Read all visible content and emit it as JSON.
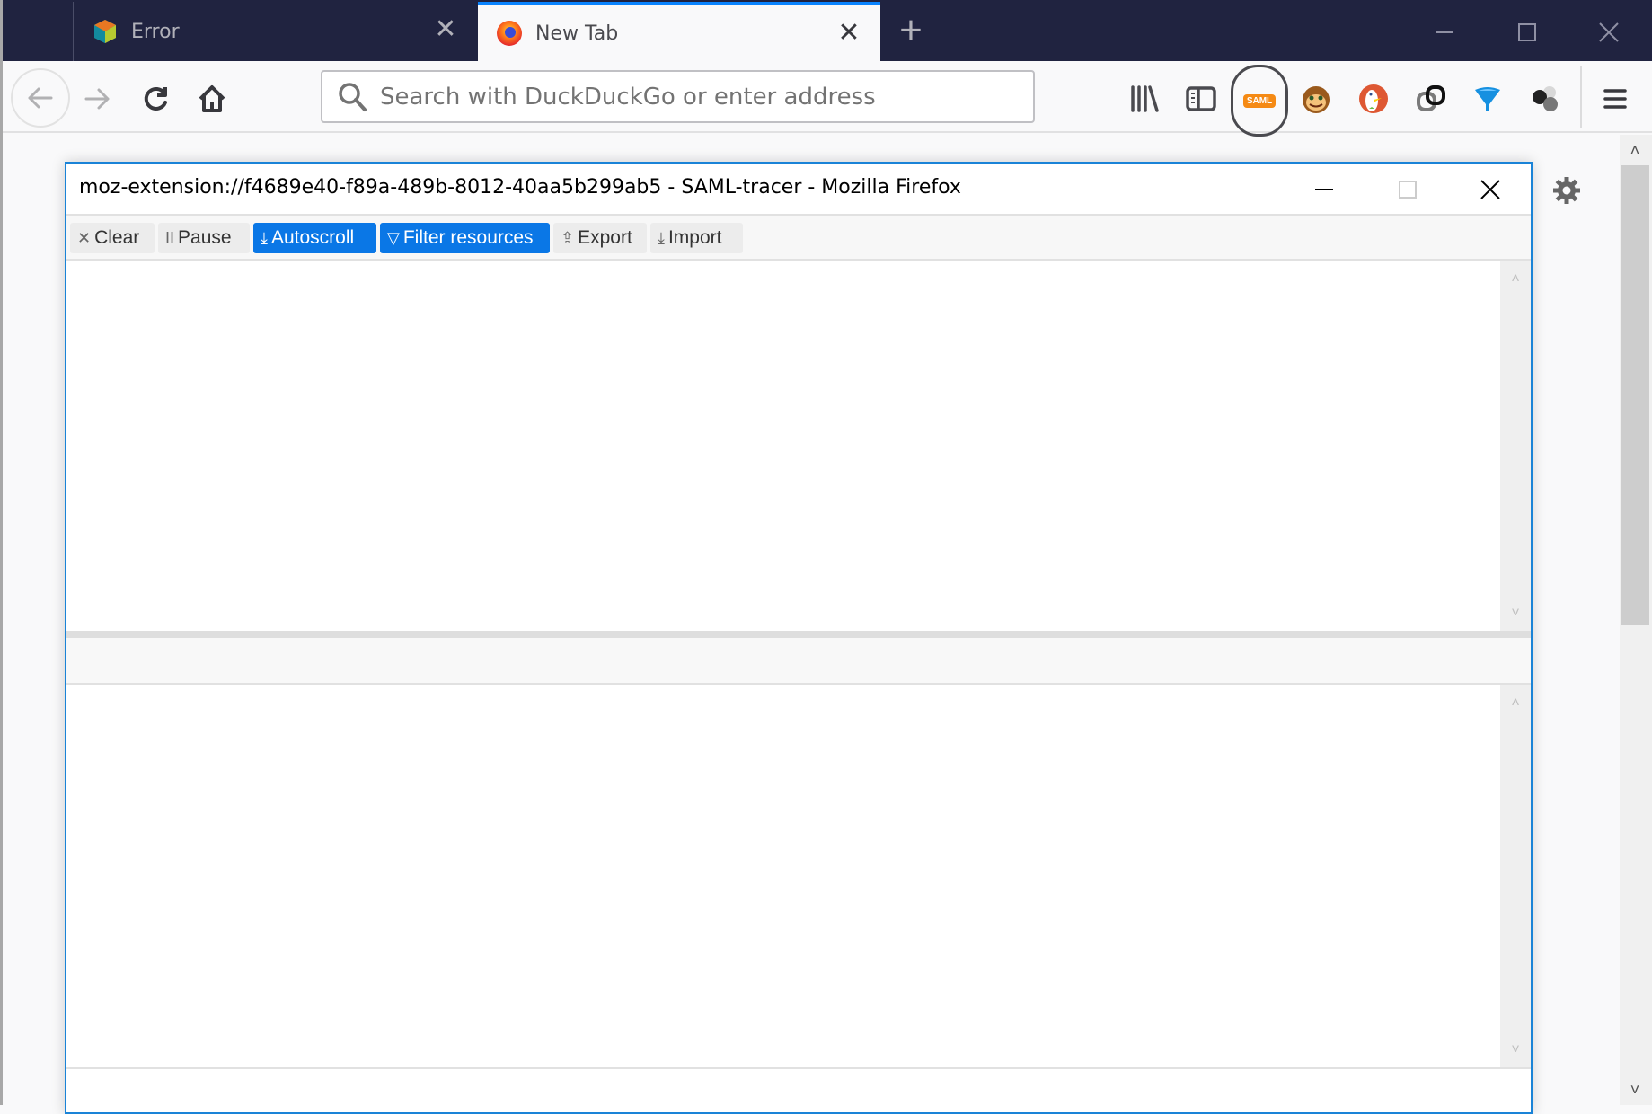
{
  "browser": {
    "tabs": [
      {
        "title": "Error",
        "icon": "multicolor-cube-icon",
        "active": false
      },
      {
        "title": "New Tab",
        "icon": "firefox-icon",
        "active": true
      }
    ],
    "new_tab_label": "+",
    "urlbar": {
      "value": "",
      "placeholder": "Search with DuckDuckGo or enter address"
    },
    "toolbar_icons": [
      "library-icon",
      "sidebar-icon",
      "saml-tracer-icon",
      "greasemonkey-icon",
      "duckduckgo-icon",
      "link-icon",
      "funnel-icon",
      "balls-icon",
      "hamburger-menu-icon"
    ],
    "saml_badge": "SAML",
    "glyphs": {
      "close": "✕",
      "up": "˄",
      "down": "˅"
    }
  },
  "popup": {
    "title": "moz-extension://f4689e40-f89a-489b-8012-40aa5b299ab5 - SAML-tracer - Mozilla Firefox",
    "toolbar": {
      "clear": {
        "label": "Clear",
        "icon": "✕"
      },
      "pause": {
        "label": "Pause",
        "icon": "II"
      },
      "autoscroll": {
        "label": "Autoscroll",
        "icon": "⤓",
        "active": true
      },
      "filter": {
        "label": "Filter resources",
        "icon": "▽",
        "active": true
      },
      "export": {
        "label": "Export",
        "icon": "⇪"
      },
      "import": {
        "label": "Import",
        "icon": "⤓"
      }
    },
    "requests": [],
    "details": []
  },
  "colors": {
    "tabbar_bg": "#202340",
    "accent_blue": "#0a77e6",
    "tab_highlight": "#0a84ff",
    "saml_orange": "#f58a14"
  }
}
